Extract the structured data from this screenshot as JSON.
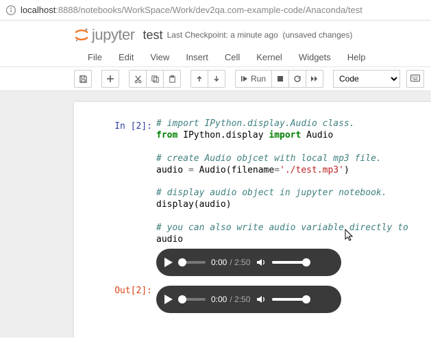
{
  "url": {
    "prefix": "localhost",
    "rest": ":8888/notebooks/WorkSpace/Work/dev2qa.com-example-code/Anaconda/test"
  },
  "logo": {
    "text": "jupyter"
  },
  "notebook": {
    "name": "test",
    "checkpoint": "Last Checkpoint: a minute ago",
    "unsaved": "(unsaved changes)"
  },
  "menus": [
    "File",
    "Edit",
    "View",
    "Insert",
    "Cell",
    "Kernel",
    "Widgets",
    "Help"
  ],
  "toolbar": {
    "run_label": "Run",
    "celltype": "Code"
  },
  "cell_in": {
    "prompt": "In [2]:",
    "code": {
      "l1_c": "# import IPython.display.Audio class.",
      "l2_k1": "from",
      "l2_n1": " IPython.display ",
      "l2_k2": "import",
      "l2_n2": " Audio",
      "l3": "",
      "l4_c": "# create Audio objcet with local mp3 file.",
      "l5_n1": "audio ",
      "l5_o": "=",
      "l5_n2": " Audio(filename",
      "l5_o2": "=",
      "l5_s": "'./test.mp3'",
      "l5_n3": ")",
      "l6": "",
      "l7_c": "# display audio object in jupyter notebook.",
      "l8": "display(audio)",
      "l9": "",
      "l10_c": "# you can also write audio variable directly to",
      "l11": "audio"
    }
  },
  "cell_out": {
    "prompt": "Out[2]:"
  },
  "audio": {
    "current": "0:00",
    "duration": "/ 2:50"
  }
}
